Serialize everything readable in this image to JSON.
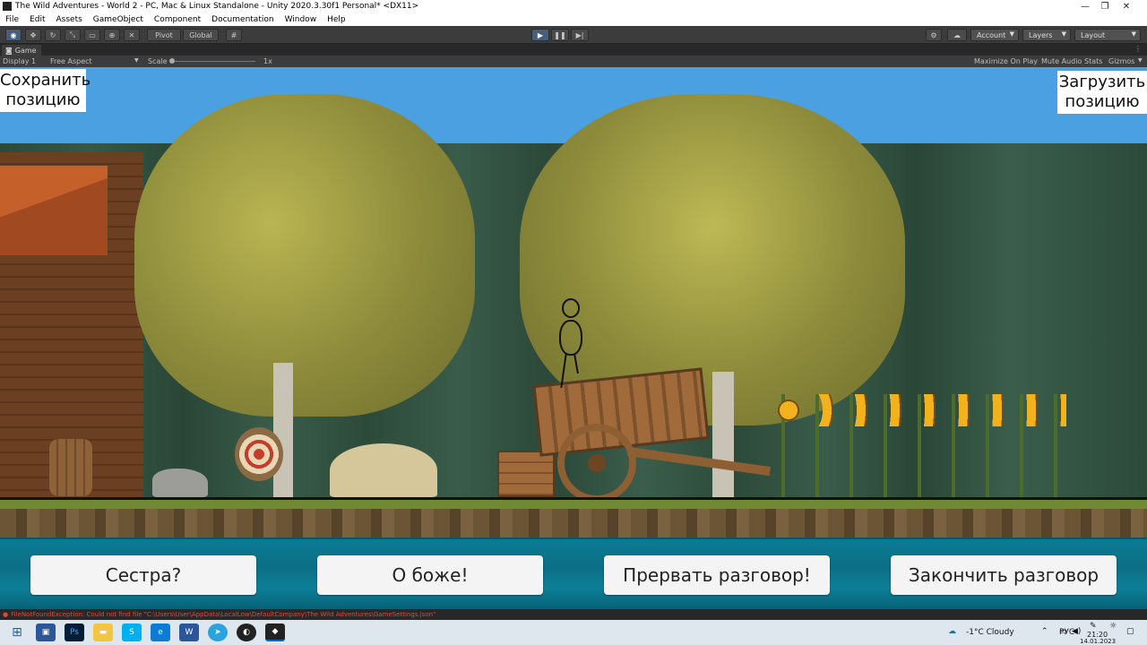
{
  "window": {
    "title": "The Wild Adventures - World 2 - PC, Mac & Linux Standalone - Unity 2020.3.30f1 Personal* <DX11>",
    "minimize": "—",
    "maximize": "❐",
    "close": "✕"
  },
  "menu": [
    "File",
    "Edit",
    "Assets",
    "GameObject",
    "Component",
    "Documentation",
    "Window",
    "Help"
  ],
  "toolbar": {
    "pivot_label": "Pivot",
    "global_label": "Global",
    "account_label": "Account",
    "layers_label": "Layers",
    "layout_label": "Layout"
  },
  "game_tab": {
    "label": "Game"
  },
  "game_bar": {
    "display": "Display 1",
    "aspect": "Free Aspect",
    "scale_label": "Scale",
    "scale_value": "1x",
    "maximize_on_play": "Maximize On Play",
    "mute_audio": "Mute Audio",
    "stats": "Stats",
    "gizmos": "Gizmos"
  },
  "game": {
    "save_position": "Сохранить позицию",
    "load_position": "Загрузить позицию",
    "choices": [
      "Сестра?",
      "О боже!",
      "Прервать разговор!",
      "Закончить разговор"
    ]
  },
  "console": {
    "error": "FileNotFoundException: Could not find file \"C:\\Users\\User\\AppData\\LocalLow\\DefaultCompany\\The Wild Adventures\\GameSettings.json\""
  },
  "taskbar": {
    "weather": "-1°C  Cloudy",
    "language": "РУС",
    "time": "21:20",
    "date": "14.01.2023"
  },
  "colors": {
    "sky": "#4aa0e0",
    "panel": "#0b6f86",
    "editor_dark": "#3c3c3c",
    "console_error": "#e0483d"
  }
}
